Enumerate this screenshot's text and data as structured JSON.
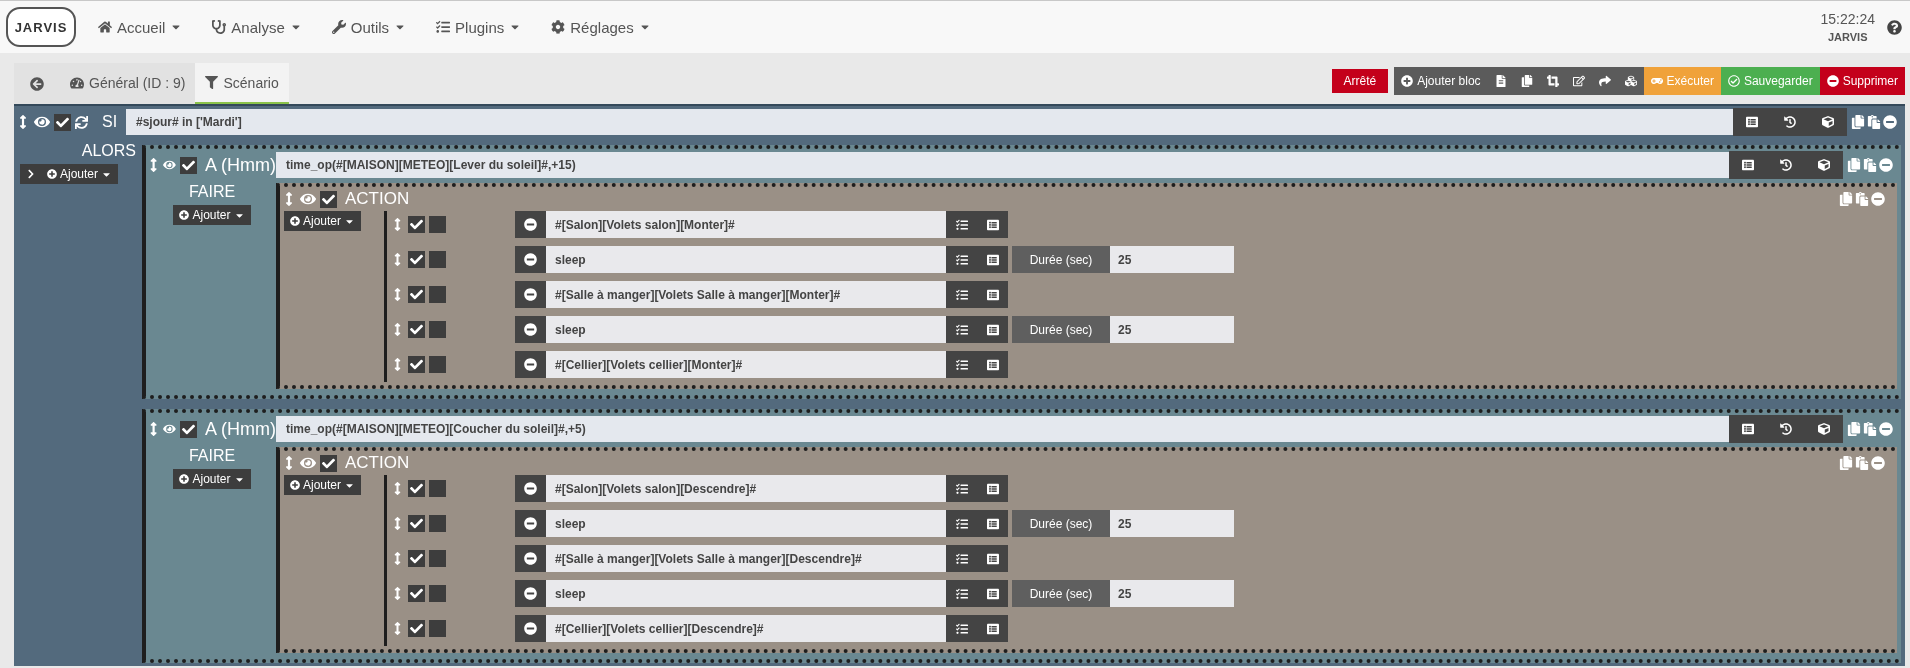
{
  "navbar": {
    "logo": "JARVIS",
    "menu": [
      {
        "label": "Accueil"
      },
      {
        "label": "Analyse"
      },
      {
        "label": "Outils"
      },
      {
        "label": "Plugins"
      },
      {
        "label": "Réglages"
      }
    ],
    "clock": "15:22:24",
    "user": "JARVIS"
  },
  "tabs": [
    {
      "label": "Général (ID : 9)",
      "selected": false
    },
    {
      "label": "Scénario",
      "selected": true
    }
  ],
  "status": "Arrêté",
  "toolbar": {
    "add_label": "Ajouter bloc",
    "actions": [
      {
        "label": "Exécuter",
        "kind": "run"
      },
      {
        "label": "Sauvegarder",
        "kind": "save"
      },
      {
        "label": "Supprimer",
        "kind": "delete"
      }
    ]
  },
  "scenario": {
    "keyword": "SI",
    "enabled": true,
    "condition": "#sjour# in ['Mardi']",
    "then_label": "ALORS",
    "add_label": "Ajouter",
    "blocks": [
      {
        "keyword": "A (Hmm)",
        "enabled": true,
        "expression": "time_op(#[MAISON][METEO][Lever du soleil]#,+15)",
        "do_label": "FAIRE",
        "add_label": "Ajouter",
        "action": {
          "title": "ACTION",
          "enabled": true,
          "add_label": "Ajouter",
          "rows": [
            {
              "enabled": true,
              "parallel": false,
              "command": "#[Salon][Volets salon][Monter]#"
            },
            {
              "enabled": true,
              "parallel": false,
              "command": "sleep",
              "option_label": "Durée (sec)",
              "option_value": "25"
            },
            {
              "enabled": true,
              "parallel": false,
              "command": "#[Salle à manger][Volets Salle à manger][Monter]#"
            },
            {
              "enabled": true,
              "parallel": false,
              "command": "sleep",
              "option_label": "Durée (sec)",
              "option_value": "25"
            },
            {
              "enabled": true,
              "parallel": false,
              "command": "#[Cellier][Volets cellier][Monter]#"
            }
          ]
        }
      },
      {
        "keyword": "A (Hmm)",
        "enabled": true,
        "expression": "time_op(#[MAISON][METEO][Coucher du soleil]#,+5)",
        "do_label": "FAIRE",
        "add_label": "Ajouter",
        "action": {
          "title": "ACTION",
          "enabled": true,
          "add_label": "Ajouter",
          "rows": [
            {
              "enabled": true,
              "parallel": false,
              "command": "#[Salon][Volets salon][Descendre]#"
            },
            {
              "enabled": true,
              "parallel": false,
              "command": "sleep",
              "option_label": "Durée (sec)",
              "option_value": "25"
            },
            {
              "enabled": true,
              "parallel": false,
              "command": "#[Salle à manger][Volets Salle à manger][Descendre]#"
            },
            {
              "enabled": true,
              "parallel": false,
              "command": "sleep",
              "option_label": "Durée (sec)",
              "option_value": "25"
            },
            {
              "enabled": true,
              "parallel": false,
              "command": "#[Cellier][Volets cellier][Descendre]#"
            }
          ]
        }
      }
    ]
  }
}
